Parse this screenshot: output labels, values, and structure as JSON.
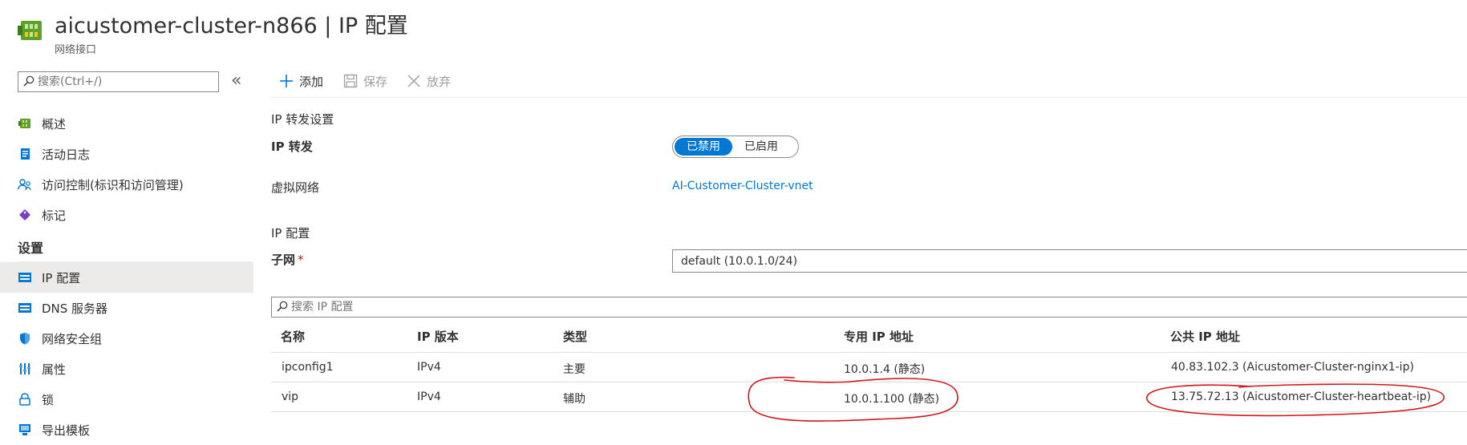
{
  "header": {
    "title": "aicustomer-cluster-n866 | IP 配置",
    "subtitle": "网络接口",
    "resource_icon": "network-interface-icon"
  },
  "sidebar": {
    "search_placeholder": "搜索(Ctrl+/)",
    "collapse_label": "«",
    "items": [
      {
        "label": "概述",
        "icon": "overview-icon"
      },
      {
        "label": "活动日志",
        "icon": "activity-log-icon"
      },
      {
        "label": "访问控制(标识和访问管理)",
        "icon": "access-control-icon"
      },
      {
        "label": "标记",
        "icon": "tag-icon"
      }
    ],
    "settings_section": "设置",
    "settings_items": [
      {
        "label": "IP 配置",
        "icon": "ip-config-icon",
        "active": true
      },
      {
        "label": "DNS 服务器",
        "icon": "dns-server-icon"
      },
      {
        "label": "网络安全组",
        "icon": "security-group-icon"
      },
      {
        "label": "属性",
        "icon": "properties-icon"
      },
      {
        "label": "锁",
        "icon": "lock-icon"
      },
      {
        "label": "导出模板",
        "icon": "export-template-icon"
      }
    ]
  },
  "toolbar": {
    "add_label": "添加",
    "save_label": "保存",
    "discard_label": "放弃"
  },
  "ip_forwarding": {
    "section_title": "IP 转发设置",
    "label": "IP 转发",
    "options": [
      "已禁用",
      "已启用"
    ],
    "selected": "已禁用"
  },
  "virtual_network": {
    "label": "虚拟网络",
    "value": "AI-Customer-Cluster-vnet"
  },
  "ip_config": {
    "section_title": "IP 配置",
    "subnet_label": "子网",
    "subnet_required": "*",
    "subnet_value": "default (10.0.1.0/24)",
    "search_placeholder": "搜索 IP 配置"
  },
  "table": {
    "columns": [
      "名称",
      "IP 版本",
      "类型",
      "专用 IP 地址",
      "公共 IP 地址"
    ],
    "rows": [
      [
        "ipconfig1",
        "IPv4",
        "主要",
        "10.0.1.4 (静态)",
        "40.83.102.3 (Aicustomer-Cluster-nginx1-ip)"
      ],
      [
        "vip",
        "IPv4",
        "辅助",
        "10.0.1.100 (静态)",
        "13.75.72.13 (Aicustomer-Cluster-heartbeat-ip)"
      ]
    ]
  },
  "colors": {
    "accent": "#0078d4",
    "annotation": "#d2161e"
  }
}
